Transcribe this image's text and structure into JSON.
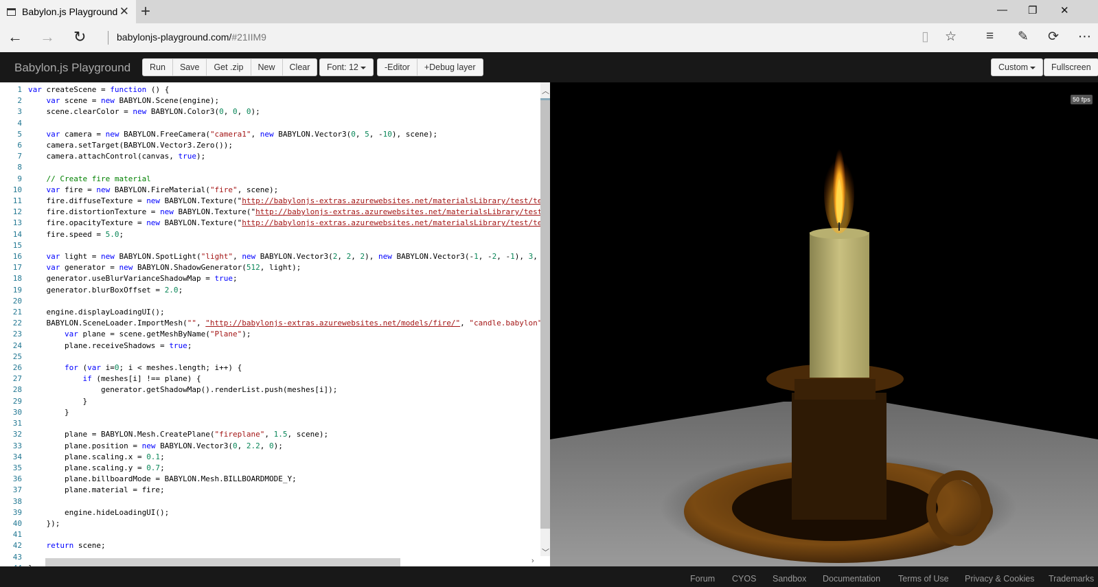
{
  "browser": {
    "tab_title": "Babylon.js Playground",
    "tab_close": "✕",
    "new_tab": "+",
    "win_min": "—",
    "win_max": "❐",
    "win_close": "✕",
    "url_host": "babylonjs-playground.com/",
    "url_hash": "#21IIM9"
  },
  "toolbar": {
    "title": "Babylon.js Playground",
    "run": "Run",
    "save": "Save",
    "zip": "Get .zip",
    "new": "New",
    "clear": "Clear",
    "font": "Font: 12",
    "editor": "-Editor",
    "debug": "+Debug layer",
    "custom": "Custom",
    "fullscreen": "Fullscreen"
  },
  "fps": "50 fps",
  "footer": {
    "forum": "Forum",
    "cyos": "CYOS",
    "sandbox": "Sandbox",
    "docs": "Documentation",
    "terms": "Terms of Use",
    "privacy": "Privacy & Cookies",
    "trademarks": "Trademarks"
  },
  "code": [
    [
      [
        "k",
        "var"
      ],
      [
        "t",
        " createScene = "
      ],
      [
        "k",
        "function"
      ],
      [
        "t",
        " () {"
      ]
    ],
    [
      [
        "t",
        "    "
      ],
      [
        "k",
        "var"
      ],
      [
        "t",
        " scene = "
      ],
      [
        "k",
        "new"
      ],
      [
        "t",
        " BABYLON.Scene(engine);"
      ]
    ],
    [
      [
        "t",
        "    scene.clearColor = "
      ],
      [
        "k",
        "new"
      ],
      [
        "t",
        " BABYLON.Color3("
      ],
      [
        "n",
        "0"
      ],
      [
        "t",
        ", "
      ],
      [
        "n",
        "0"
      ],
      [
        "t",
        ", "
      ],
      [
        "n",
        "0"
      ],
      [
        "t",
        ");"
      ]
    ],
    [],
    [
      [
        "t",
        "    "
      ],
      [
        "k",
        "var"
      ],
      [
        "t",
        " camera = "
      ],
      [
        "k",
        "new"
      ],
      [
        "t",
        " BABYLON.FreeCamera("
      ],
      [
        "s",
        "\"camera1\""
      ],
      [
        "t",
        ", "
      ],
      [
        "k",
        "new"
      ],
      [
        "t",
        " BABYLON.Vector3("
      ],
      [
        "n",
        "0"
      ],
      [
        "t",
        ", "
      ],
      [
        "n",
        "5"
      ],
      [
        "t",
        ", -"
      ],
      [
        "n",
        "10"
      ],
      [
        "t",
        "), scene);"
      ]
    ],
    [
      [
        "t",
        "    camera.setTarget(BABYLON.Vector3.Zero());"
      ]
    ],
    [
      [
        "t",
        "    camera.attachControl(canvas, "
      ],
      [
        "k",
        "true"
      ],
      [
        "t",
        ");"
      ]
    ],
    [],
    [
      [
        "c",
        "    // Create fire material"
      ]
    ],
    [
      [
        "t",
        "    "
      ],
      [
        "k",
        "var"
      ],
      [
        "t",
        " fire = "
      ],
      [
        "k",
        "new"
      ],
      [
        "t",
        " BABYLON.FireMaterial("
      ],
      [
        "s",
        "\"fire\""
      ],
      [
        "t",
        ", scene);"
      ]
    ],
    [
      [
        "t",
        "    fire.diffuseTexture = "
      ],
      [
        "k",
        "new"
      ],
      [
        "t",
        " BABYLON.Texture(\""
      ],
      [
        "u",
        "http://babylonjs-extras.azurewebsites.net/materialsLibrary/test/textu"
      ]
    ],
    [
      [
        "t",
        "    fire.distortionTexture = "
      ],
      [
        "k",
        "new"
      ],
      [
        "t",
        " BABYLON.Texture(\""
      ],
      [
        "u",
        "http://babylonjs-extras.azurewebsites.net/materialsLibrary/test/te"
      ]
    ],
    [
      [
        "t",
        "    fire.opacityTexture = "
      ],
      [
        "k",
        "new"
      ],
      [
        "t",
        " BABYLON.Texture(\""
      ],
      [
        "u",
        "http://babylonjs-extras.azurewebsites.net/materialsLibrary/test/textu"
      ]
    ],
    [
      [
        "t",
        "    fire.speed = "
      ],
      [
        "n",
        "5.0"
      ],
      [
        "t",
        ";"
      ]
    ],
    [],
    [
      [
        "t",
        "    "
      ],
      [
        "k",
        "var"
      ],
      [
        "t",
        " light = "
      ],
      [
        "k",
        "new"
      ],
      [
        "t",
        " BABYLON.SpotLight("
      ],
      [
        "s",
        "\"light\""
      ],
      [
        "t",
        ", "
      ],
      [
        "k",
        "new"
      ],
      [
        "t",
        " BABYLON.Vector3("
      ],
      [
        "n",
        "2"
      ],
      [
        "t",
        ", "
      ],
      [
        "n",
        "2"
      ],
      [
        "t",
        ", "
      ],
      [
        "n",
        "2"
      ],
      [
        "t",
        "), "
      ],
      [
        "k",
        "new"
      ],
      [
        "t",
        " BABYLON.Vector3(-"
      ],
      [
        "n",
        "1"
      ],
      [
        "t",
        ", -"
      ],
      [
        "n",
        "2"
      ],
      [
        "t",
        ", -"
      ],
      [
        "n",
        "1"
      ],
      [
        "t",
        "), "
      ],
      [
        "n",
        "3"
      ],
      [
        "t",
        ", "
      ],
      [
        "n",
        "1"
      ],
      [
        "t",
        ","
      ]
    ],
    [
      [
        "t",
        "    "
      ],
      [
        "k",
        "var"
      ],
      [
        "t",
        " generator = "
      ],
      [
        "k",
        "new"
      ],
      [
        "t",
        " BABYLON.ShadowGenerator("
      ],
      [
        "n",
        "512"
      ],
      [
        "t",
        ", light);"
      ]
    ],
    [
      [
        "t",
        "    generator.useBlurVarianceShadowMap = "
      ],
      [
        "k",
        "true"
      ],
      [
        "t",
        ";"
      ]
    ],
    [
      [
        "t",
        "    generator.blurBoxOffset = "
      ],
      [
        "n",
        "2.0"
      ],
      [
        "t",
        ";"
      ]
    ],
    [],
    [
      [
        "t",
        "    engine.displayLoadingUI();"
      ]
    ],
    [
      [
        "t",
        "    BABYLON.SceneLoader.ImportMesh("
      ],
      [
        "s",
        "\"\""
      ],
      [
        "t",
        ", "
      ],
      [
        "u",
        "\"http://babylonjs-extras.azurewebsites.net/models/fire/\""
      ],
      [
        "t",
        ", "
      ],
      [
        "s",
        "\"candle.babylon\""
      ],
      [
        "t",
        ", s"
      ]
    ],
    [
      [
        "t",
        "        "
      ],
      [
        "k",
        "var"
      ],
      [
        "t",
        " plane = scene.getMeshByName("
      ],
      [
        "s",
        "\"Plane\""
      ],
      [
        "t",
        ");"
      ]
    ],
    [
      [
        "t",
        "        plane.receiveShadows = "
      ],
      [
        "k",
        "true"
      ],
      [
        "t",
        ";"
      ]
    ],
    [],
    [
      [
        "t",
        "        "
      ],
      [
        "k",
        "for"
      ],
      [
        "t",
        " ("
      ],
      [
        "k",
        "var"
      ],
      [
        "t",
        " i="
      ],
      [
        "n",
        "0"
      ],
      [
        "t",
        "; i < meshes.length; i++) {"
      ]
    ],
    [
      [
        "t",
        "            "
      ],
      [
        "k",
        "if"
      ],
      [
        "t",
        " (meshes[i] !== plane) {"
      ]
    ],
    [
      [
        "t",
        "                generator.getShadowMap().renderList.push(meshes[i]);"
      ]
    ],
    [
      [
        "t",
        "            }"
      ]
    ],
    [
      [
        "t",
        "        }"
      ]
    ],
    [],
    [
      [
        "t",
        "        plane = BABYLON.Mesh.CreatePlane("
      ],
      [
        "s",
        "\"fireplane\""
      ],
      [
        "t",
        ", "
      ],
      [
        "n",
        "1.5"
      ],
      [
        "t",
        ", scene);"
      ]
    ],
    [
      [
        "t",
        "        plane.position = "
      ],
      [
        "k",
        "new"
      ],
      [
        "t",
        " BABYLON.Vector3("
      ],
      [
        "n",
        "0"
      ],
      [
        "t",
        ", "
      ],
      [
        "n",
        "2.2"
      ],
      [
        "t",
        ", "
      ],
      [
        "n",
        "0"
      ],
      [
        "t",
        ");"
      ]
    ],
    [
      [
        "t",
        "        plane.scaling.x = "
      ],
      [
        "n",
        "0.1"
      ],
      [
        "t",
        ";"
      ]
    ],
    [
      [
        "t",
        "        plane.scaling.y = "
      ],
      [
        "n",
        "0.7"
      ],
      [
        "t",
        ";"
      ]
    ],
    [
      [
        "t",
        "        plane.billboardMode = BABYLON.Mesh.BILLBOARDMODE_Y;"
      ]
    ],
    [
      [
        "t",
        "        plane.material = fire;"
      ]
    ],
    [],
    [
      [
        "t",
        "        engine.hideLoadingUI();"
      ]
    ],
    [
      [
        "t",
        "    });"
      ]
    ],
    [],
    [
      [
        "t",
        "    "
      ],
      [
        "k",
        "return"
      ],
      [
        "t",
        " scene;"
      ]
    ],
    [],
    [
      [
        "t",
        "}"
      ]
    ]
  ],
  "colors": {
    "toolbar_bg": "#181818",
    "keyword": "#0000ff",
    "string": "#a31515",
    "number": "#098658",
    "comment": "#008000",
    "line_number": "#237893"
  }
}
